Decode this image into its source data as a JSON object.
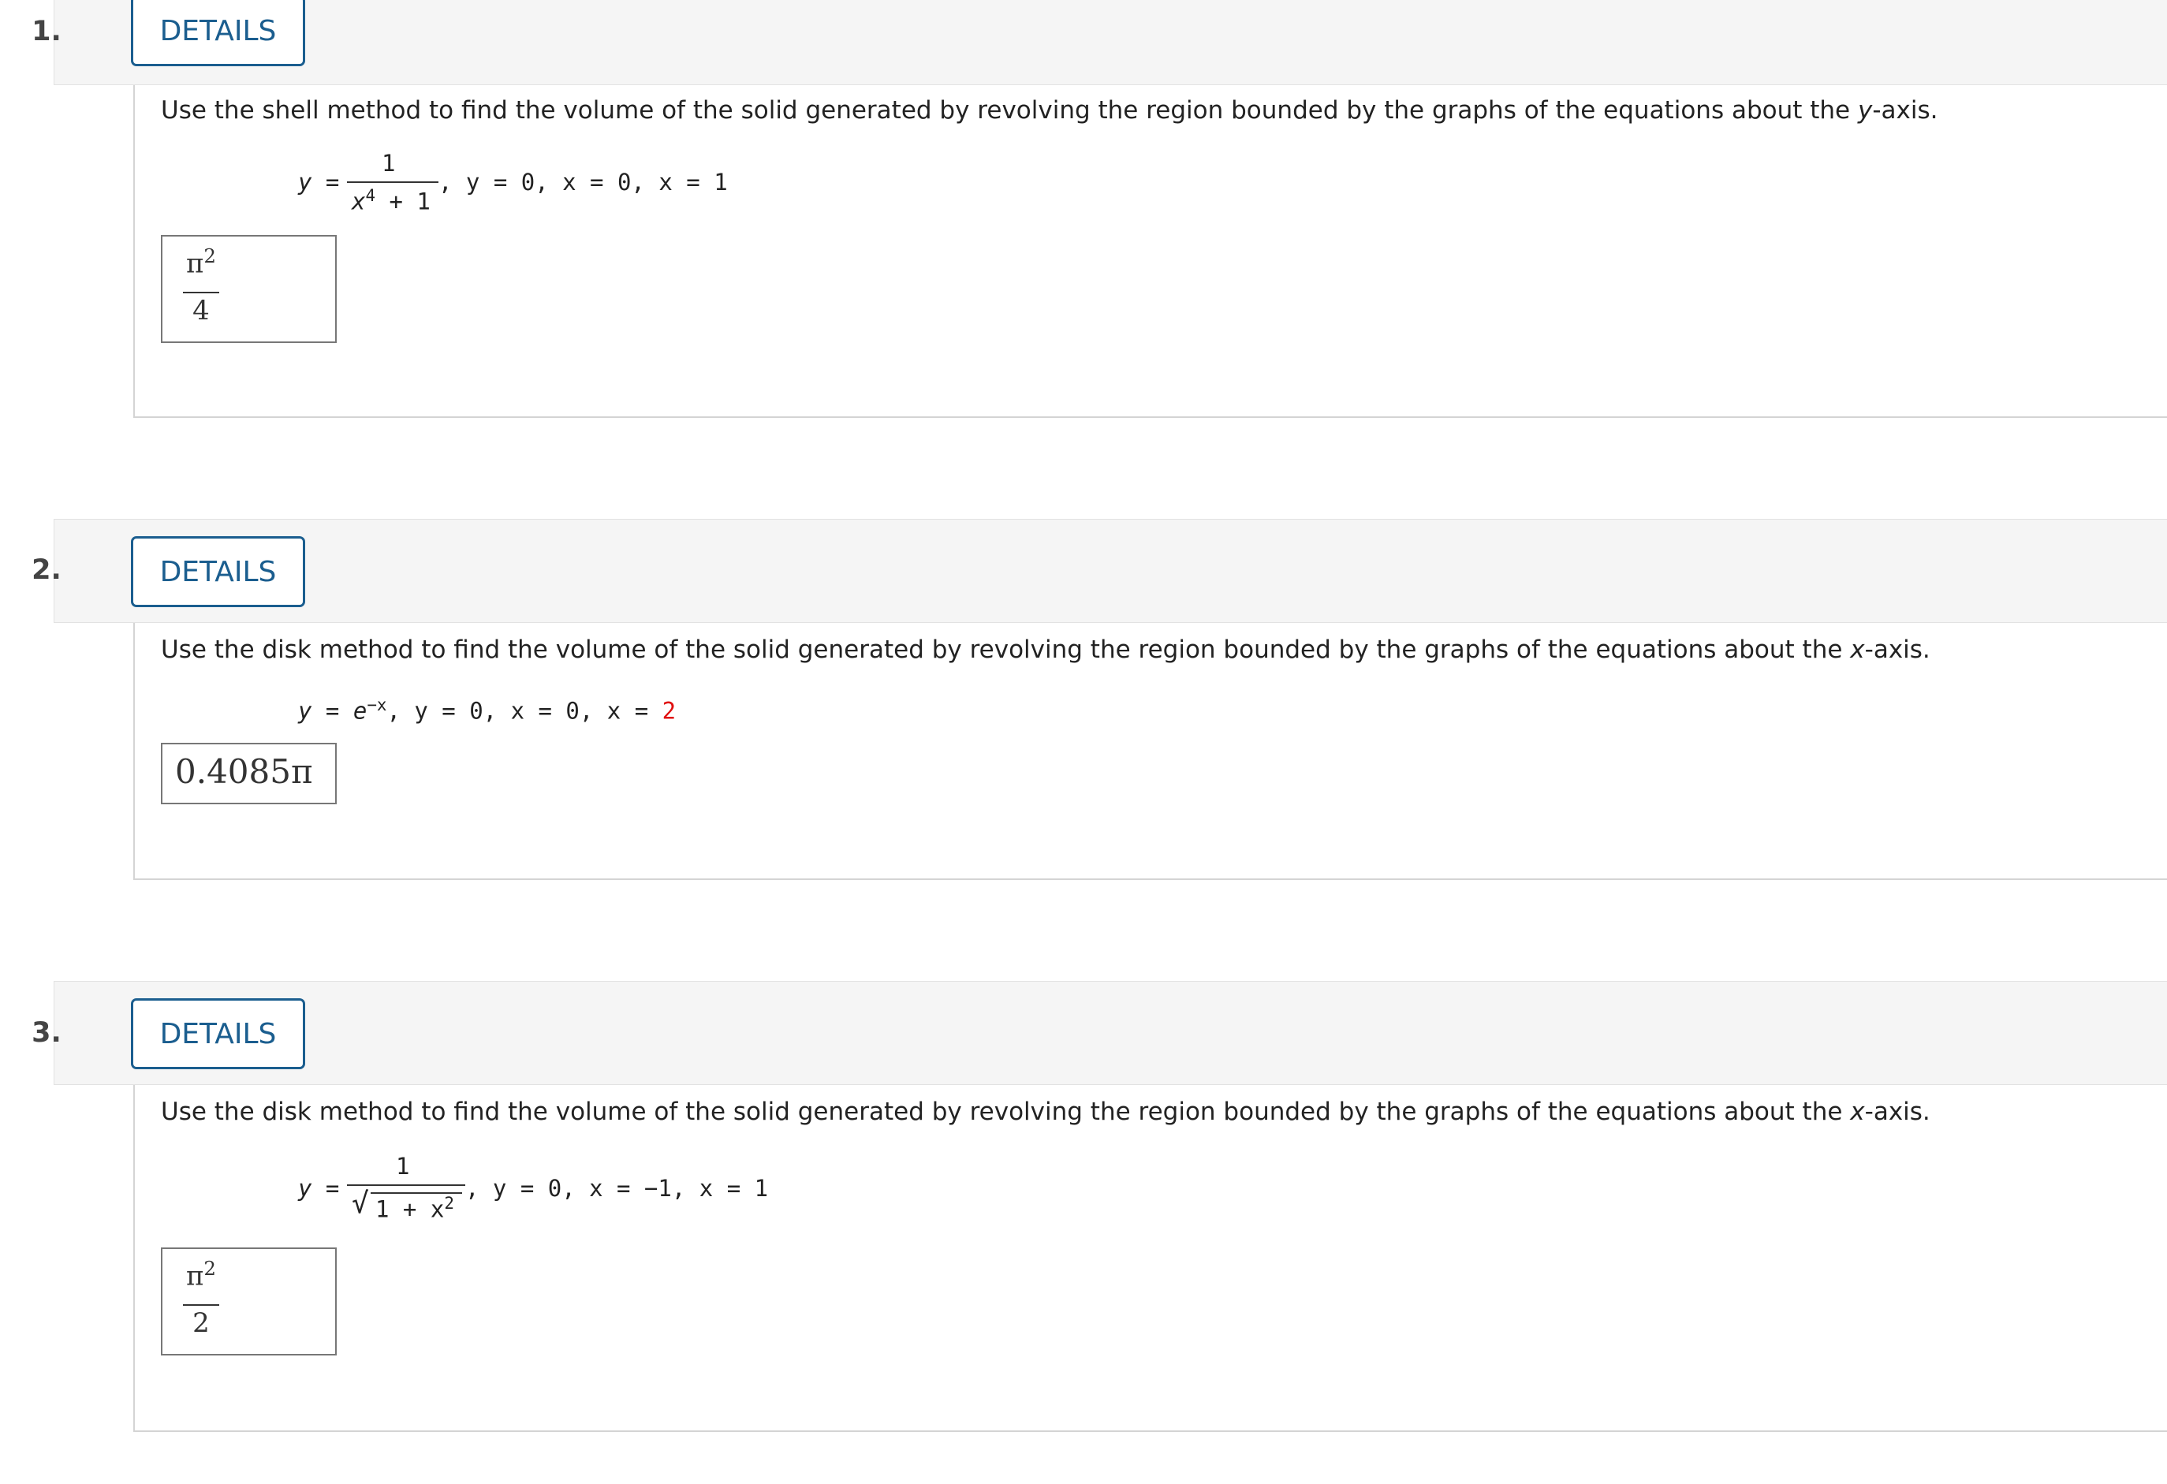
{
  "questions": [
    {
      "number": "1.",
      "details_label": "DETAILS",
      "prompt_pre": "Use the shell method to find the volume of the solid generated by revolving the region bounded by the graphs of the equations about the ",
      "prompt_axis_var": "y",
      "prompt_post": "-axis.",
      "equation": {
        "lhs": "y =",
        "numerator": "1",
        "denominator_base": "x",
        "denominator_exp": "4",
        "denominator_rest": " + 1",
        "rest": ",   y = 0,   x = 0,   x = 1"
      },
      "answer": {
        "numerator_base": "π",
        "numerator_exp": "2",
        "denominator": "4"
      }
    },
    {
      "number": "2.",
      "details_label": "DETAILS",
      "prompt_pre": "Use the disk method to find the volume of the solid generated by revolving the region bounded by the graphs of the equations about the ",
      "prompt_axis_var": "x",
      "prompt_post": "-axis.",
      "equation": {
        "lhs": "y = e",
        "exp": "−x",
        "rest": ",   y = 0,   x = 0,   x = ",
        "highlight": "2"
      },
      "answer": {
        "value": "0.4085π"
      }
    },
    {
      "number": "3.",
      "details_label": "DETAILS",
      "prompt_pre": "Use the disk method to find the volume of the solid generated by revolving the region bounded by the graphs of the equations about the ",
      "prompt_axis_var": "x",
      "prompt_post": "-axis.",
      "equation": {
        "lhs": "y =",
        "numerator": "1",
        "radical": "√",
        "radicand_pre": "1 + x",
        "radicand_exp": "2",
        "rest": ",   y = 0,   x = −1,   x = 1"
      },
      "answer": {
        "numerator_base": "π",
        "numerator_exp": "2",
        "denominator": "2"
      }
    }
  ],
  "colors": {
    "accent": "#1b5e8f",
    "highlight": "#e01010",
    "header_bg": "#f5f5f5"
  }
}
